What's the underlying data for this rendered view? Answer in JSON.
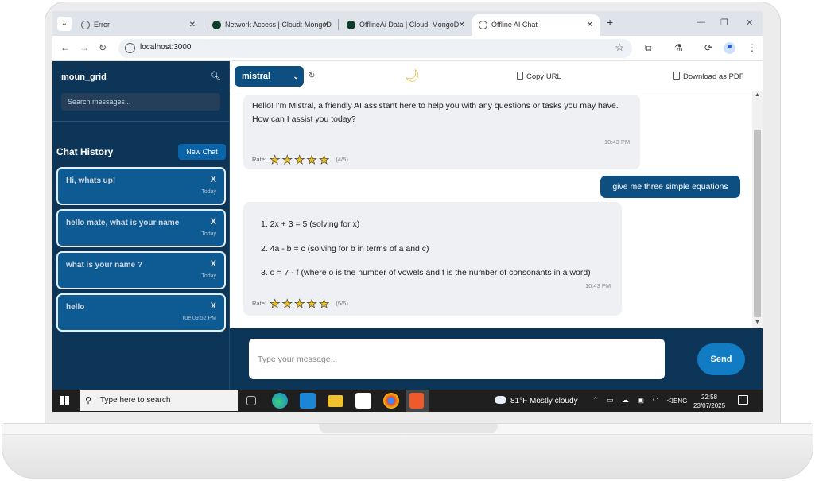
{
  "browser": {
    "tabs": [
      {
        "title": "Error",
        "active": false
      },
      {
        "title": "Network Access | Cloud: MongoD",
        "active": false
      },
      {
        "title": "OfflineAi Data | Cloud: MongoD",
        "active": false
      },
      {
        "title": "Offline AI Chat",
        "active": true
      }
    ],
    "url": "localhost:3000"
  },
  "sidebar": {
    "title": "moun_grid",
    "search_placeholder": "Search messages...",
    "history_heading": "Chat History",
    "new_chat_label": "New Chat",
    "chats": [
      {
        "title": "Hi, whats up!",
        "time": "Today",
        "close": "X"
      },
      {
        "title": "hello mate, what is your name",
        "time": "Today",
        "close": "X"
      },
      {
        "title": "what is your name ?",
        "time": "Today",
        "close": "X"
      },
      {
        "title": "hello",
        "time": "Tue 09:52 PM",
        "close": "X"
      }
    ]
  },
  "toolbar": {
    "model": "mistral",
    "copy_url": "Copy URL",
    "download_pdf": "Download as PDF"
  },
  "messages": [
    {
      "role": "assistant",
      "text": "Hello! I'm Mistral, a friendly AI assistant here to help you with any questions or tasks you may have. How can I assist you today?",
      "time": "10:43 PM",
      "rate_label": "Rate:",
      "rating": "(4/5)",
      "stars": 5
    },
    {
      "role": "user",
      "text": "give me three simple equations"
    },
    {
      "role": "assistant",
      "lines": [
        "1. 2x + 3 = 5 (solving for x)",
        "2. 4a - b = c (solving for b in terms of a and c)",
        "3. o = 7 - f (where o is the number of vowels and f is the number of consonants in a word)"
      ],
      "time": "10:43 PM",
      "rate_label": "Rate:",
      "rating": "(5/5)",
      "stars": 5
    }
  ],
  "composer": {
    "placeholder": "Type your message...",
    "send_label": "Send"
  },
  "taskbar": {
    "search_placeholder": "Type here to search",
    "weather": "81°F  Mostly cloudy",
    "language": "ENG",
    "time": "22:58",
    "date": "23/07/2025"
  }
}
